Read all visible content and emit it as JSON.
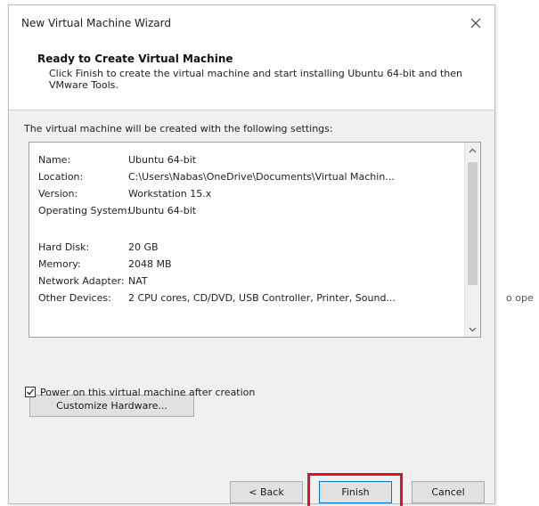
{
  "background": {
    "partial_text": "o ope"
  },
  "dialog": {
    "title": "New Virtual Machine Wizard",
    "close_icon": "close-icon",
    "header": {
      "title": "Ready to Create Virtual Machine",
      "description": "Click Finish to create the virtual machine and start installing Ubuntu 64-bit and then VMware Tools."
    },
    "settings_label": "The virtual machine will be created with the following settings:",
    "settings": [
      {
        "key": "Name:",
        "value": "Ubuntu 64-bit"
      },
      {
        "key": "Location:",
        "value": "C:\\Users\\Nabas\\OneDrive\\Documents\\Virtual Machin..."
      },
      {
        "key": "Version:",
        "value": "Workstation 15.x"
      },
      {
        "key": "Operating System:",
        "value": "Ubuntu 64-bit"
      },
      {
        "key": "Hard Disk:",
        "value": "20 GB"
      },
      {
        "key": "Memory:",
        "value": "2048 MB"
      },
      {
        "key": "Network Adapter:",
        "value": "NAT"
      },
      {
        "key": "Other Devices:",
        "value": "2 CPU cores, CD/DVD, USB Controller, Printer, Sound..."
      }
    ],
    "customize_label": "Customize Hardware...",
    "power_on": {
      "label": "Power on this virtual machine after creation",
      "checked": true
    },
    "buttons": {
      "back": "< Back",
      "finish": "Finish",
      "cancel": "Cancel"
    },
    "highlight_color": "#e0141e"
  }
}
